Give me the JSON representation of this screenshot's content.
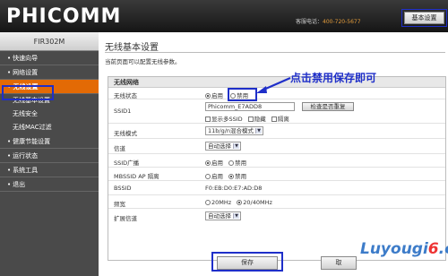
{
  "header": {
    "logo": "PHICOMM",
    "hotline_label": "客服电话：",
    "hotline_number": "400-720-5677",
    "basic_settings_button": "基本设置"
  },
  "sidebar": {
    "model": "FIR302M",
    "items": [
      {
        "label": "快速向导",
        "active": false
      },
      {
        "label": "网络设置",
        "active": false
      },
      {
        "label": "无线设置",
        "active": true
      }
    ],
    "subitems": [
      "无线基本设置",
      "无线安全",
      "无线MAC过滤"
    ],
    "items_after": [
      {
        "label": "健康节能设置"
      },
      {
        "label": "运行状态"
      },
      {
        "label": "系统工具"
      },
      {
        "label": "退出"
      }
    ]
  },
  "main": {
    "title": "无线基本设置",
    "description": "当前页面可以配置无线参数。",
    "section_title": "无线网络",
    "fields": {
      "wireless_status": {
        "label": "无线状态",
        "options": [
          "启用",
          "禁用"
        ],
        "selected": "启用"
      },
      "ssid1": {
        "label": "SSID1",
        "value": "Phicomm_E7ADD8",
        "check_button": "检查是否重复",
        "options": [
          "显示多SSID",
          "隐藏",
          "隔离"
        ]
      },
      "wireless_mode": {
        "label": "无线模式",
        "value": "11b/g/n混合模式"
      },
      "channel": {
        "label": "信道",
        "value": "自动选择"
      },
      "ssid_broadcast": {
        "label": "SSID广播",
        "options": [
          "启用",
          "禁用"
        ],
        "selected": "启用"
      },
      "mbssid_isolation": {
        "label": "MBSSID AP 隔离",
        "options": [
          "启用",
          "禁用"
        ],
        "selected": "禁用"
      },
      "bssid": {
        "label": "BSSID",
        "value": "F0:EB:D0:E7:AD:D8"
      },
      "bandwidth": {
        "label": "频宽",
        "options": [
          "20MHz",
          "20/40MHz"
        ],
        "selected": "20/40MHz"
      },
      "ext_channel": {
        "label": "扩展信道",
        "value": "自动选择"
      }
    },
    "save_button": "保存",
    "cancel_button": "取"
  },
  "annotation": {
    "text": "点击禁用保存即可",
    "color": "#1f2fc9"
  },
  "watermark": {
    "part1": "Luyougi",
    "part2": "6",
    "part3": ".cn"
  },
  "colors": {
    "accent": "#e36a05",
    "highlight_frame": "#1f2fc9",
    "header": "#262626",
    "sidebar": "#4a4a4a"
  }
}
